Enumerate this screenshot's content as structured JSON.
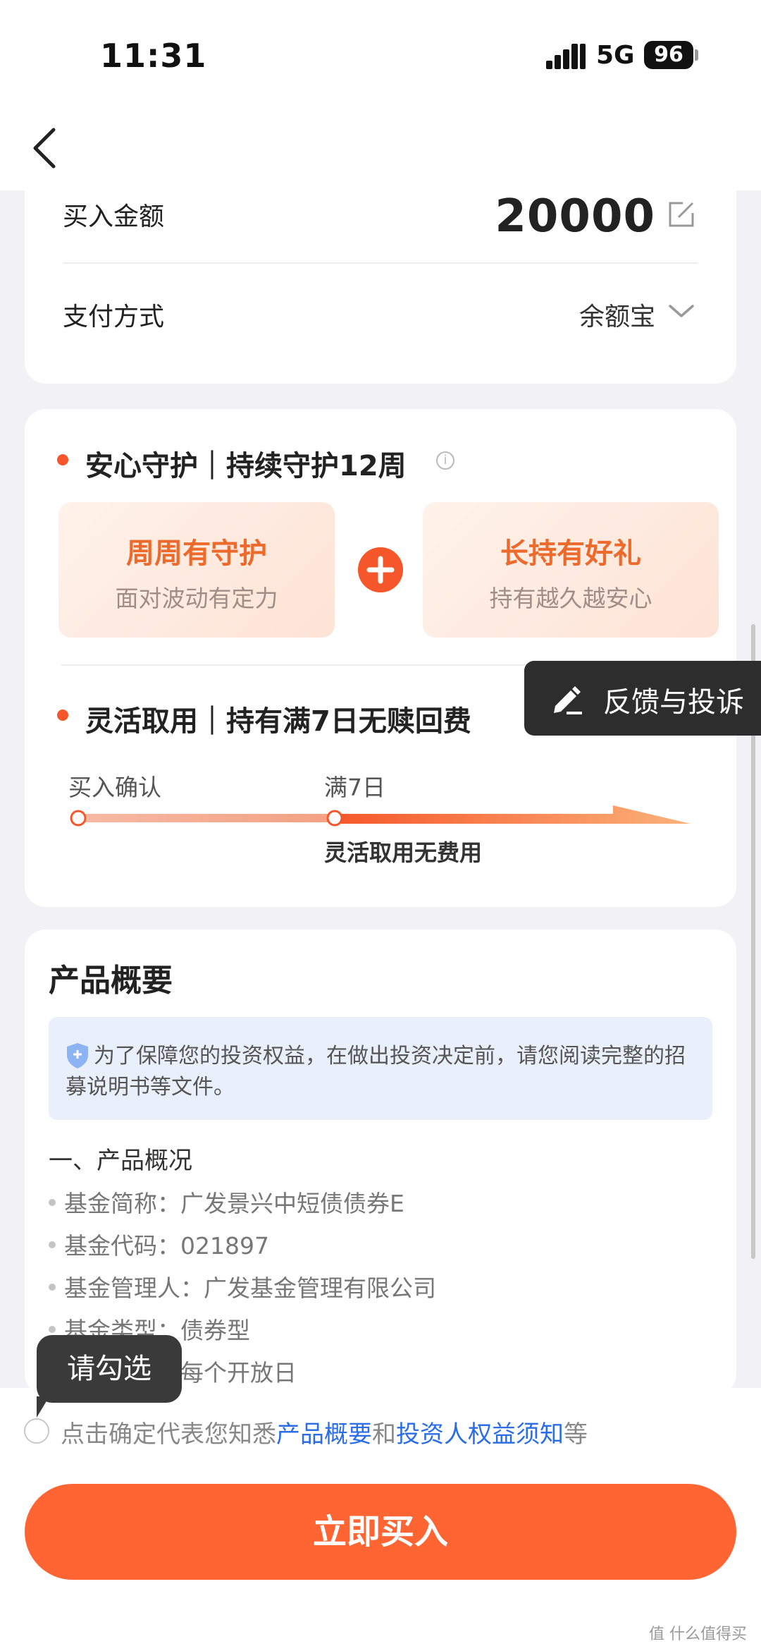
{
  "status_bar": {
    "time": "11:31",
    "network": "5G",
    "battery": "96"
  },
  "purchase": {
    "amount_label": "买入金额",
    "amount_value": "20000",
    "payment_label": "支付方式",
    "payment_value": "余额宝"
  },
  "protection": {
    "title": "安心守护｜持续守护12周",
    "features": [
      {
        "title": "周周有守护",
        "subtitle": "面对波动有定力"
      },
      {
        "title": "长持有好礼",
        "subtitle": "持有越久越安心"
      }
    ],
    "flex_title": "灵活取用｜持有满7日无赎回费",
    "timeline": {
      "start_label": "买入确认",
      "mid_label": "满7日",
      "note": "灵活取用无费用"
    }
  },
  "feedback": {
    "label": "反馈与投诉"
  },
  "product": {
    "title": "产品概要",
    "notice": "为了保障您的投资权益，在做出投资决定前，请您阅读完整的招募说明书等文件。",
    "section_heading": "一、产品概况",
    "items": [
      "基金简称：广发景兴中短债债券E",
      "基金代码：021897",
      "基金管理人：广发基金管理有限公司",
      "基金类型：债券型",
      "申赎频率：每个开放日"
    ]
  },
  "tooltip": {
    "text": "请勾选"
  },
  "agreement": {
    "prefix": "点击确定代表您知悉",
    "link1": "产品概要",
    "and": "和",
    "link2": "投资人权益须知",
    "suffix": "等"
  },
  "buy_button": {
    "label": "立即买入"
  },
  "watermark": "值 什么值得买",
  "colors": {
    "accent": "#f5572a",
    "button": "#ff6533",
    "link": "#2b6de5"
  }
}
